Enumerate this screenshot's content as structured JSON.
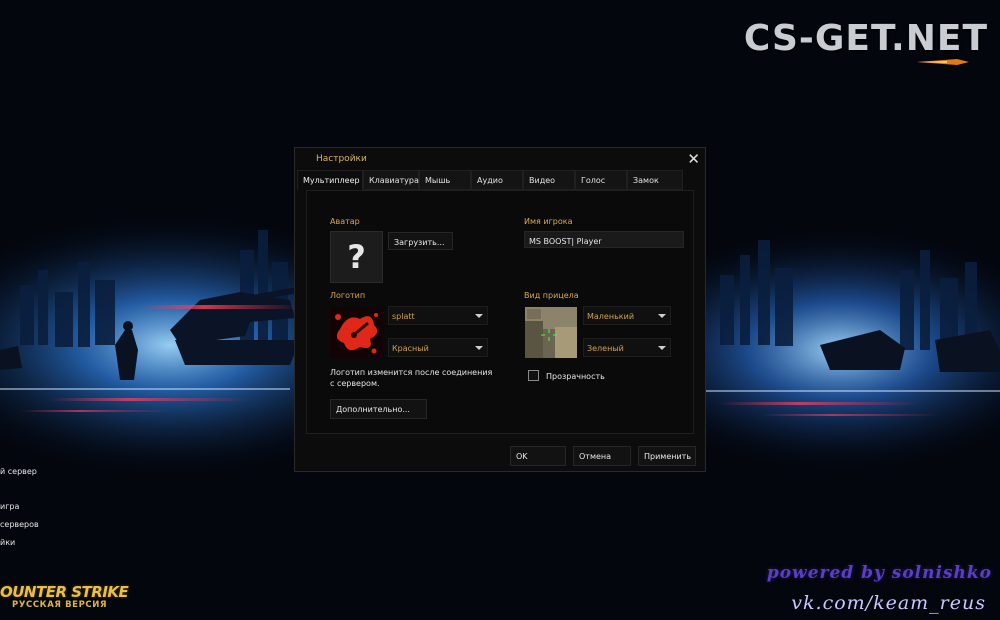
{
  "watermark": "CS-GET.NET",
  "left_menu": [
    "й сервер",
    "игра",
    "серверов",
    "йки"
  ],
  "cs_logo": {
    "line1": "OUNTER STRIKE",
    "line2": "РУССКАЯ ВЕРСИЯ"
  },
  "credits": {
    "line1": "powered by solnishko",
    "line2": "vk.com/keam_reus"
  },
  "dialog": {
    "title": "Настройки",
    "close": "✕",
    "tabs": [
      "Мультиплеер",
      "Клавиатура",
      "Мышь",
      "Аудио",
      "Видео",
      "Голос",
      "Замок"
    ],
    "active_tab": "Мультиплеер",
    "avatar": {
      "label": "Аватар",
      "placeholder_glyph": "?",
      "load_button": "Загрузить..."
    },
    "player_name": {
      "label": "Имя игрока",
      "value": "MS BOOST| Player"
    },
    "logo": {
      "label": "Логотип",
      "type_value": "splatt",
      "color_value": "Красный",
      "note": "Логотип изменится после соединения с сервером.",
      "advanced_button": "Дополнительно..."
    },
    "crosshair": {
      "label": "Вид прицела",
      "size_value": "Маленький",
      "color_value": "Зеленый",
      "transparency_label": "Прозрачность",
      "transparency_checked": false
    },
    "buttons": {
      "ok": "OK",
      "cancel": "Отмена",
      "apply": "Применить"
    }
  },
  "colors": {
    "accent_label": "#d8a85a",
    "logo_red": "#e0281a",
    "crosshair_green": "#3cff3c"
  }
}
